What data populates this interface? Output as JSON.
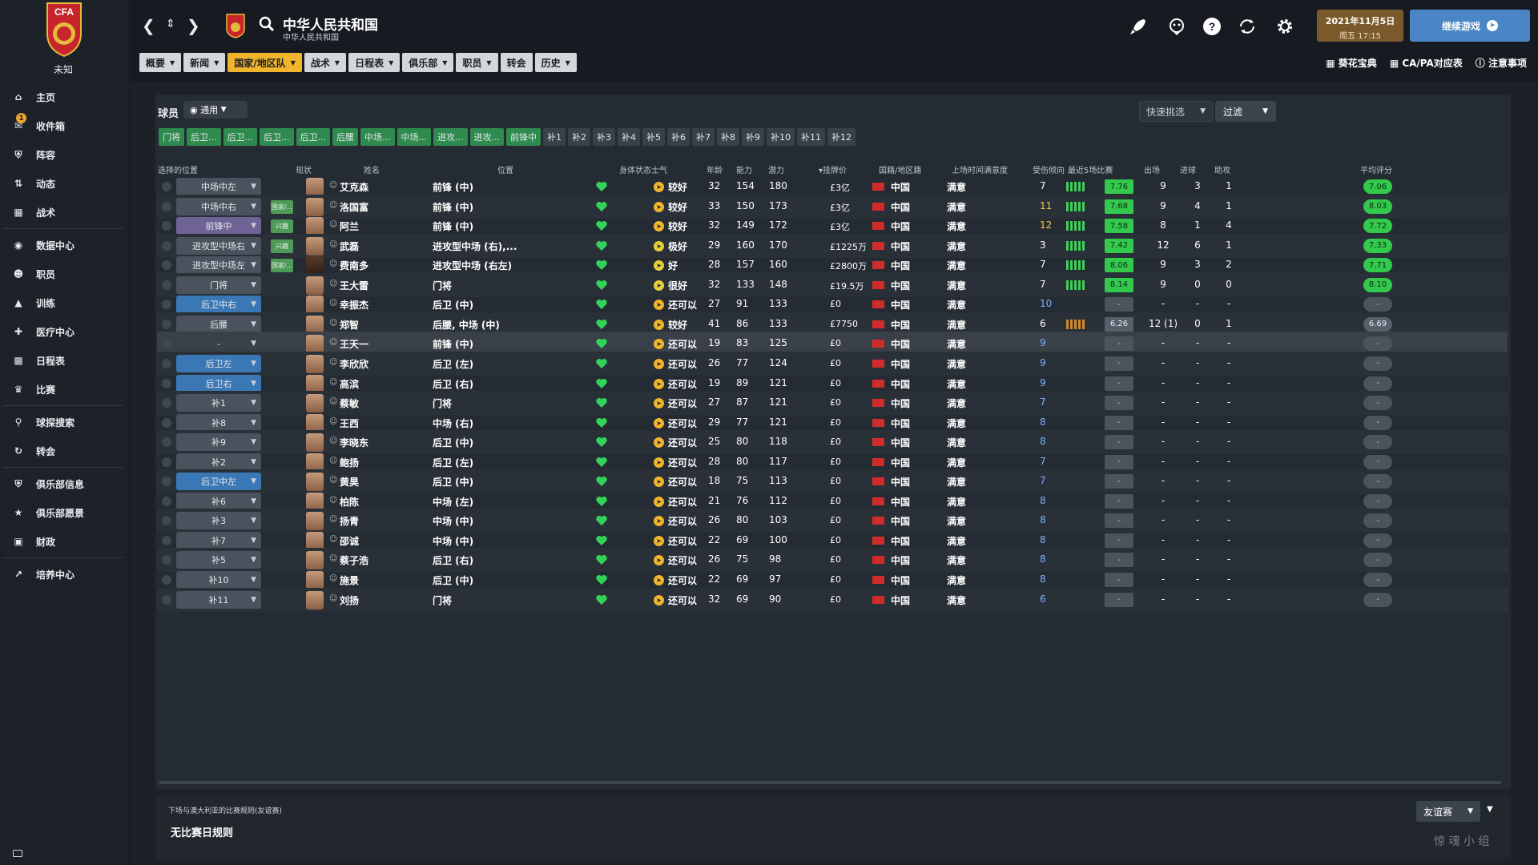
{
  "club": {
    "name": "未知",
    "crest_text": "CFA"
  },
  "sidebar": {
    "items": [
      {
        "label": "主页",
        "icon": "home-icon"
      },
      {
        "label": "收件箱",
        "icon": "inbox-icon",
        "badge": "1"
      },
      {
        "label": "阵容",
        "icon": "shirt-icon"
      },
      {
        "label": "动态",
        "icon": "dynamics-icon"
      },
      {
        "label": "战术",
        "icon": "tactics-icon"
      },
      {
        "label": "数据中心",
        "icon": "data-hub-icon"
      },
      {
        "label": "职员",
        "icon": "staff-icon"
      },
      {
        "label": "训练",
        "icon": "training-icon"
      },
      {
        "label": "医疗中心",
        "icon": "medical-icon"
      },
      {
        "label": "日程表",
        "icon": "calendar-icon"
      },
      {
        "label": "比赛",
        "icon": "trophy-icon"
      },
      {
        "label": "球探搜索",
        "icon": "search-icon"
      },
      {
        "label": "转会",
        "icon": "transfer-icon"
      },
      {
        "label": "俱乐部信息",
        "icon": "shield-icon"
      },
      {
        "label": "俱乐部愿景",
        "icon": "vision-icon"
      },
      {
        "label": "财政",
        "icon": "finance-icon"
      },
      {
        "label": "培养中心",
        "icon": "development-icon"
      }
    ]
  },
  "header": {
    "title": "中华人民共和国",
    "subtitle": "中华人民共和国",
    "date": "2021年11月5日",
    "time": "周五 17:15",
    "continue_label": "继续游戏"
  },
  "menu": [
    {
      "label": "概要",
      "active": false
    },
    {
      "label": "新闻",
      "active": false
    },
    {
      "label": "国家/地区队",
      "active": true
    },
    {
      "label": "战术",
      "active": false
    },
    {
      "label": "日程表",
      "active": false
    },
    {
      "label": "俱乐部",
      "active": false
    },
    {
      "label": "职员",
      "active": false
    },
    {
      "label": "转会",
      "active": false,
      "no_caret": true
    },
    {
      "label": "历史",
      "active": false
    }
  ],
  "right_links": [
    "葵花宝典",
    "CA/PA对应表",
    "注意事项"
  ],
  "panel": {
    "label": "球员",
    "view": "通用",
    "quick_pick": "快速挑选",
    "filter": "过滤"
  },
  "chips": [
    {
      "label": "门将",
      "type": "g"
    },
    {
      "label": "后卫...",
      "type": "g"
    },
    {
      "label": "后卫...",
      "type": "g"
    },
    {
      "label": "后卫...",
      "type": "g"
    },
    {
      "label": "后卫...",
      "type": "g"
    },
    {
      "label": "后腰",
      "type": "g"
    },
    {
      "label": "中场...",
      "type": "g"
    },
    {
      "label": "中场...",
      "type": "g"
    },
    {
      "label": "进攻...",
      "type": "g"
    },
    {
      "label": "进攻...",
      "type": "g"
    },
    {
      "label": "前锋中",
      "type": "g"
    },
    {
      "label": "补1",
      "type": "sub"
    },
    {
      "label": "补2",
      "type": "sub"
    },
    {
      "label": "补3",
      "type": "sub"
    },
    {
      "label": "补4",
      "type": "sub"
    },
    {
      "label": "补5",
      "type": "sub"
    },
    {
      "label": "补6",
      "type": "sub"
    },
    {
      "label": "补7",
      "type": "sub"
    },
    {
      "label": "补8",
      "type": "sub"
    },
    {
      "label": "补9",
      "type": "sub"
    },
    {
      "label": "补10",
      "type": "sub"
    },
    {
      "label": "补11",
      "type": "sub"
    },
    {
      "label": "补12",
      "type": "sub"
    }
  ],
  "columns": {
    "sel_pos": "选择的位置",
    "status": "现状",
    "name": "姓名",
    "position": "位置",
    "condition": "身体状态",
    "morale": "士气",
    "age": "年龄",
    "ca": "能力",
    "pa": "潜力",
    "value": "▾挂牌价",
    "nation": "国籍/地区籍",
    "playtime": "上场时间满意度",
    "injury": "受伤倾向",
    "form": "最近5场比赛",
    "apps": "出场",
    "goals": "进球",
    "assists": "助攻",
    "avg": "平均评分"
  },
  "players": [
    {
      "sel": "中场中左",
      "selc": "",
      "status": "",
      "name": "艾克森",
      "pos": "前锋 (中)",
      "morale": "较好",
      "age": "32",
      "ca": "154",
      "pa": "180",
      "value": "£3亿",
      "nation": "中国",
      "sat": "满意",
      "inj": "7",
      "injc": "w",
      "bars": "g",
      "form": "7.76",
      "apps": "9",
      "goals": "3",
      "assists": "1",
      "avg": "7.06",
      "dark": false
    },
    {
      "sel": "中场中右",
      "selc": "",
      "status": "国家/...",
      "name": "洛国富",
      "pos": "前锋 (中)",
      "morale": "较好",
      "age": "33",
      "ca": "150",
      "pa": "173",
      "value": "£3亿",
      "nation": "中国",
      "sat": "满意",
      "inj": "11",
      "injc": "y",
      "bars": "g",
      "form": "7.68",
      "apps": "9",
      "goals": "4",
      "assists": "1",
      "avg": "8.03",
      "dark": false
    },
    {
      "sel": "前锋中",
      "selc": "purple",
      "status": "兴趣",
      "name": "阿兰",
      "pos": "前锋 (中)",
      "morale": "较好",
      "age": "32",
      "ca": "149",
      "pa": "172",
      "value": "£3亿",
      "nation": "中国",
      "sat": "满意",
      "inj": "12",
      "injc": "y",
      "bars": "g",
      "form": "7.58",
      "apps": "8",
      "goals": "1",
      "assists": "4",
      "avg": "7.72",
      "dark": false
    },
    {
      "sel": "进攻型中场右",
      "selc": "",
      "status": "兴趣",
      "name": "武磊",
      "pos": "进攻型中场 (右),...",
      "morale": "极好",
      "age": "29",
      "ca": "160",
      "pa": "170",
      "value": "£1225万",
      "nation": "中国",
      "sat": "满意",
      "inj": "3",
      "injc": "w",
      "bars": "g",
      "form": "7.42",
      "apps": "12",
      "goals": "6",
      "assists": "1",
      "avg": "7.33",
      "dark": false
    },
    {
      "sel": "进攻型中场左",
      "selc": "",
      "status": "国家/...",
      "name": "费南多",
      "pos": "进攻型中场 (右左)",
      "morale": "好",
      "age": "28",
      "ca": "157",
      "pa": "160",
      "value": "£2800万",
      "nation": "中国",
      "sat": "满意",
      "inj": "7",
      "injc": "w",
      "bars": "g",
      "form": "8.06",
      "apps": "9",
      "goals": "3",
      "assists": "2",
      "avg": "7.71",
      "dark": true
    },
    {
      "sel": "门将",
      "selc": "",
      "status": "",
      "name": "王大雷",
      "pos": "门将",
      "morale": "很好",
      "age": "32",
      "ca": "133",
      "pa": "148",
      "value": "£19.5万",
      "nation": "中国",
      "sat": "满意",
      "inj": "7",
      "injc": "w",
      "bars": "g",
      "form": "8.14",
      "apps": "9",
      "goals": "0",
      "assists": "0",
      "avg": "8.10",
      "dark": false
    },
    {
      "sel": "后卫中右",
      "selc": "blue",
      "status": "",
      "name": "幸振杰",
      "pos": "后卫 (中)",
      "morale": "还可以",
      "age": "27",
      "ca": "91",
      "pa": "133",
      "value": "£0",
      "nation": "中国",
      "sat": "满意",
      "inj": "10",
      "injc": "b",
      "bars": "",
      "form": "-",
      "apps": "-",
      "goals": "-",
      "assists": "-",
      "avg": "-",
      "dark": false
    },
    {
      "sel": "后腰",
      "selc": "",
      "status": "",
      "name": "郑智",
      "pos": "后腰, 中场 (中)",
      "morale": "较好",
      "age": "41",
      "ca": "86",
      "pa": "133",
      "value": "£7750",
      "nation": "中国",
      "sat": "满意",
      "inj": "6",
      "injc": "w",
      "bars": "o",
      "form": "6.26",
      "apps": "12 (1)",
      "goals": "0",
      "assists": "1",
      "avg": "6.69",
      "dark": false
    },
    {
      "sel": "-",
      "selc": "none",
      "status": "",
      "name": "王天一",
      "pos": "前锋 (中)",
      "morale": "还可以",
      "age": "19",
      "ca": "83",
      "pa": "125",
      "value": "£0",
      "nation": "中国",
      "sat": "满意",
      "inj": "9",
      "injc": "b",
      "bars": "",
      "form": "-",
      "apps": "-",
      "goals": "-",
      "assists": "-",
      "avg": "-",
      "dark": false
    },
    {
      "sel": "后卫左",
      "selc": "blue",
      "status": "",
      "name": "李欣欣",
      "pos": "后卫 (左)",
      "morale": "还可以",
      "age": "26",
      "ca": "77",
      "pa": "124",
      "value": "£0",
      "nation": "中国",
      "sat": "满意",
      "inj": "9",
      "injc": "b",
      "bars": "",
      "form": "-",
      "apps": "-",
      "goals": "-",
      "assists": "-",
      "avg": "-",
      "dark": false
    },
    {
      "sel": "后卫右",
      "selc": "blue",
      "status": "",
      "name": "高滨",
      "pos": "后卫 (右)",
      "morale": "还可以",
      "age": "19",
      "ca": "89",
      "pa": "121",
      "value": "£0",
      "nation": "中国",
      "sat": "满意",
      "inj": "9",
      "injc": "b",
      "bars": "",
      "form": "-",
      "apps": "-",
      "goals": "-",
      "assists": "-",
      "avg": "-",
      "dark": false
    },
    {
      "sel": "补1",
      "selc": "",
      "status": "",
      "name": "蔡敏",
      "pos": "门将",
      "morale": "还可以",
      "age": "27",
      "ca": "87",
      "pa": "121",
      "value": "£0",
      "nation": "中国",
      "sat": "满意",
      "inj": "7",
      "injc": "b",
      "bars": "",
      "form": "-",
      "apps": "-",
      "goals": "-",
      "assists": "-",
      "avg": "-",
      "dark": false
    },
    {
      "sel": "补8",
      "selc": "",
      "status": "",
      "name": "王西",
      "pos": "中场 (右)",
      "morale": "还可以",
      "age": "29",
      "ca": "77",
      "pa": "121",
      "value": "£0",
      "nation": "中国",
      "sat": "满意",
      "inj": "8",
      "injc": "b",
      "bars": "",
      "form": "-",
      "apps": "-",
      "goals": "-",
      "assists": "-",
      "avg": "-",
      "dark": false
    },
    {
      "sel": "补9",
      "selc": "",
      "status": "",
      "name": "李晓东",
      "pos": "后卫 (中)",
      "morale": "还可以",
      "age": "25",
      "ca": "80",
      "pa": "118",
      "value": "£0",
      "nation": "中国",
      "sat": "满意",
      "inj": "8",
      "injc": "b",
      "bars": "",
      "form": "-",
      "apps": "-",
      "goals": "-",
      "assists": "-",
      "avg": "-",
      "dark": false
    },
    {
      "sel": "补2",
      "selc": "",
      "status": "",
      "name": "鲍扬",
      "pos": "后卫 (左)",
      "morale": "还可以",
      "age": "28",
      "ca": "80",
      "pa": "117",
      "value": "£0",
      "nation": "中国",
      "sat": "满意",
      "inj": "7",
      "injc": "b",
      "bars": "",
      "form": "-",
      "apps": "-",
      "goals": "-",
      "assists": "-",
      "avg": "-",
      "dark": false
    },
    {
      "sel": "后卫中左",
      "selc": "blue",
      "status": "",
      "name": "黄昊",
      "pos": "后卫 (中)",
      "morale": "还可以",
      "age": "18",
      "ca": "75",
      "pa": "113",
      "value": "£0",
      "nation": "中国",
      "sat": "满意",
      "inj": "7",
      "injc": "b",
      "bars": "",
      "form": "-",
      "apps": "-",
      "goals": "-",
      "assists": "-",
      "avg": "-",
      "dark": false
    },
    {
      "sel": "补6",
      "selc": "",
      "status": "",
      "name": "柏陈",
      "pos": "中场 (左)",
      "morale": "还可以",
      "age": "21",
      "ca": "76",
      "pa": "112",
      "value": "£0",
      "nation": "中国",
      "sat": "满意",
      "inj": "8",
      "injc": "b",
      "bars": "",
      "form": "-",
      "apps": "-",
      "goals": "-",
      "assists": "-",
      "avg": "-",
      "dark": false
    },
    {
      "sel": "补3",
      "selc": "",
      "status": "",
      "name": "扬青",
      "pos": "中场 (中)",
      "morale": "还可以",
      "age": "26",
      "ca": "80",
      "pa": "103",
      "value": "£0",
      "nation": "中国",
      "sat": "满意",
      "inj": "8",
      "injc": "b",
      "bars": "",
      "form": "-",
      "apps": "-",
      "goals": "-",
      "assists": "-",
      "avg": "-",
      "dark": false
    },
    {
      "sel": "补7",
      "selc": "",
      "status": "",
      "name": "邵诚",
      "pos": "中场 (中)",
      "morale": "还可以",
      "age": "22",
      "ca": "69",
      "pa": "100",
      "value": "£0",
      "nation": "中国",
      "sat": "满意",
      "inj": "8",
      "injc": "b",
      "bars": "",
      "form": "-",
      "apps": "-",
      "goals": "-",
      "assists": "-",
      "avg": "-",
      "dark": false
    },
    {
      "sel": "补5",
      "selc": "",
      "status": "",
      "name": "蔡子浩",
      "pos": "后卫 (右)",
      "morale": "还可以",
      "age": "26",
      "ca": "75",
      "pa": "98",
      "value": "£0",
      "nation": "中国",
      "sat": "满意",
      "inj": "8",
      "injc": "b",
      "bars": "",
      "form": "-",
      "apps": "-",
      "goals": "-",
      "assists": "-",
      "avg": "-",
      "dark": false
    },
    {
      "sel": "补10",
      "selc": "",
      "status": "",
      "name": "施景",
      "pos": "后卫 (中)",
      "morale": "还可以",
      "age": "22",
      "ca": "69",
      "pa": "97",
      "value": "£0",
      "nation": "中国",
      "sat": "满意",
      "inj": "8",
      "injc": "b",
      "bars": "",
      "form": "-",
      "apps": "-",
      "goals": "-",
      "assists": "-",
      "avg": "-",
      "dark": false
    },
    {
      "sel": "补11",
      "selc": "",
      "status": "",
      "name": "刘扬",
      "pos": "门将",
      "morale": "还可以",
      "age": "32",
      "ca": "69",
      "pa": "90",
      "value": "£0",
      "nation": "中国",
      "sat": "满意",
      "inj": "6",
      "injc": "b",
      "bars": "",
      "form": "-",
      "apps": "-",
      "goals": "-",
      "assists": "-",
      "avg": "-",
      "dark": false
    }
  ],
  "footer": {
    "note": "下场与澳大利亚的比赛规则(友谊赛)",
    "rule": "无比赛日规则",
    "competition": "友谊赛"
  },
  "watermark": "惊 魂 小 组",
  "colors": {
    "accent": "#f0b52c",
    "continue": "#4a86c5",
    "form_green": "#32c94c",
    "flag_red": "#d12c2c"
  }
}
